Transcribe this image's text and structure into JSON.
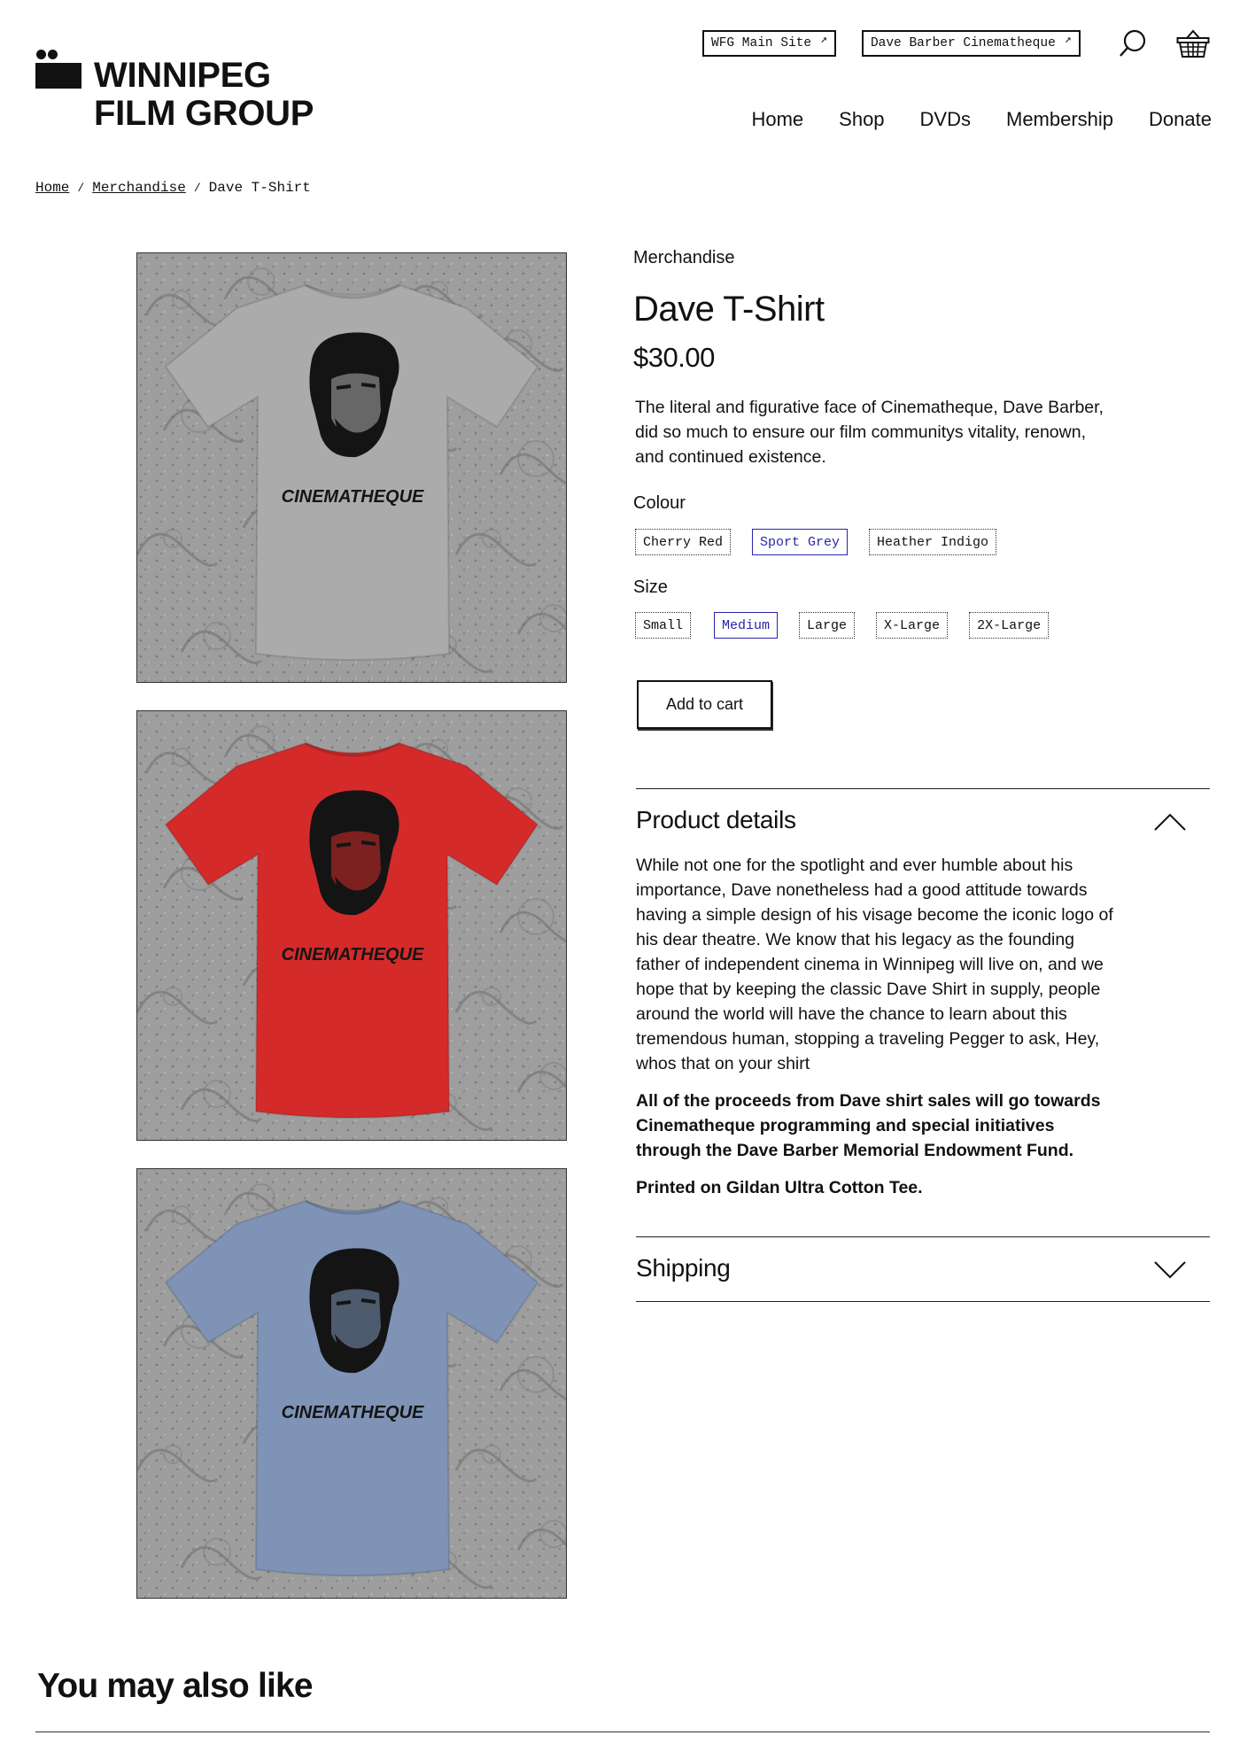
{
  "header": {
    "logo_line1": "WINNIPEG",
    "logo_line2": "FILM GROUP",
    "ext_links": [
      {
        "label": "WFG Main Site",
        "icon": "external-arrow-icon"
      },
      {
        "label": "Dave Barber Cinematheque",
        "icon": "external-arrow-icon"
      }
    ],
    "icons": [
      "search-icon",
      "basket-icon"
    ],
    "nav": [
      "Home",
      "Shop",
      "DVDs",
      "Membership",
      "Donate"
    ]
  },
  "breadcrumb": {
    "items": [
      "Home",
      "Merchandise"
    ],
    "separator": "/",
    "current": "Dave T-Shirt"
  },
  "gallery": [
    {
      "alt": "Sport Grey shirt",
      "shirt_color": "#ababab",
      "print_text": "CINEMATHEQUE"
    },
    {
      "alt": "Cherry Red shirt",
      "shirt_color": "#d42a2a",
      "print_text": "CINEMATHEQUE"
    },
    {
      "alt": "Heather Indigo shirt",
      "shirt_color": "#7e93b6",
      "print_text": "CINEMATHEQUE"
    }
  ],
  "product": {
    "category": "Merchandise",
    "title": "Dave T-Shirt",
    "price": "$30.00",
    "description": "The literal and figurative face of Cinematheque, Dave Barber, did so much to ensure our film communitys vitality, renown, and continued existence.",
    "colour_label": "Colour",
    "colours": [
      "Cherry Red",
      "Sport Grey",
      "Heather Indigo"
    ],
    "selected_colour": "Sport Grey",
    "size_label": "Size",
    "sizes": [
      "Small",
      "Medium",
      "Large",
      "X-Large",
      "2X-Large"
    ],
    "selected_size": "Medium",
    "add_to_cart": "Add to cart",
    "selected_accent": "#2a24a8"
  },
  "details": {
    "title": "Product details",
    "expanded": true,
    "body": "While not one for the spotlight and ever humble about his importance, Dave nonetheless had a good attitude towards having a simple design of his visage become the iconic logo of his dear theatre. We know that his legacy as the founding father of independent cinema in Winnipeg will live on, and we hope that by keeping the classic Dave Shirt in supply, people around the world will have the chance to learn about this tremendous human, stopping a traveling Pegger to ask, Hey, whos that on your shirt",
    "bold1": "All of the proceeds from Dave shirt sales will go towards Cinematheque programming and special initiatives through the Dave Barber Memorial Endowment Fund.",
    "bold2": "Printed on Gildan Ultra Cotton Tee."
  },
  "shipping": {
    "title": "Shipping",
    "expanded": false
  },
  "related": {
    "title": "You may also like"
  }
}
